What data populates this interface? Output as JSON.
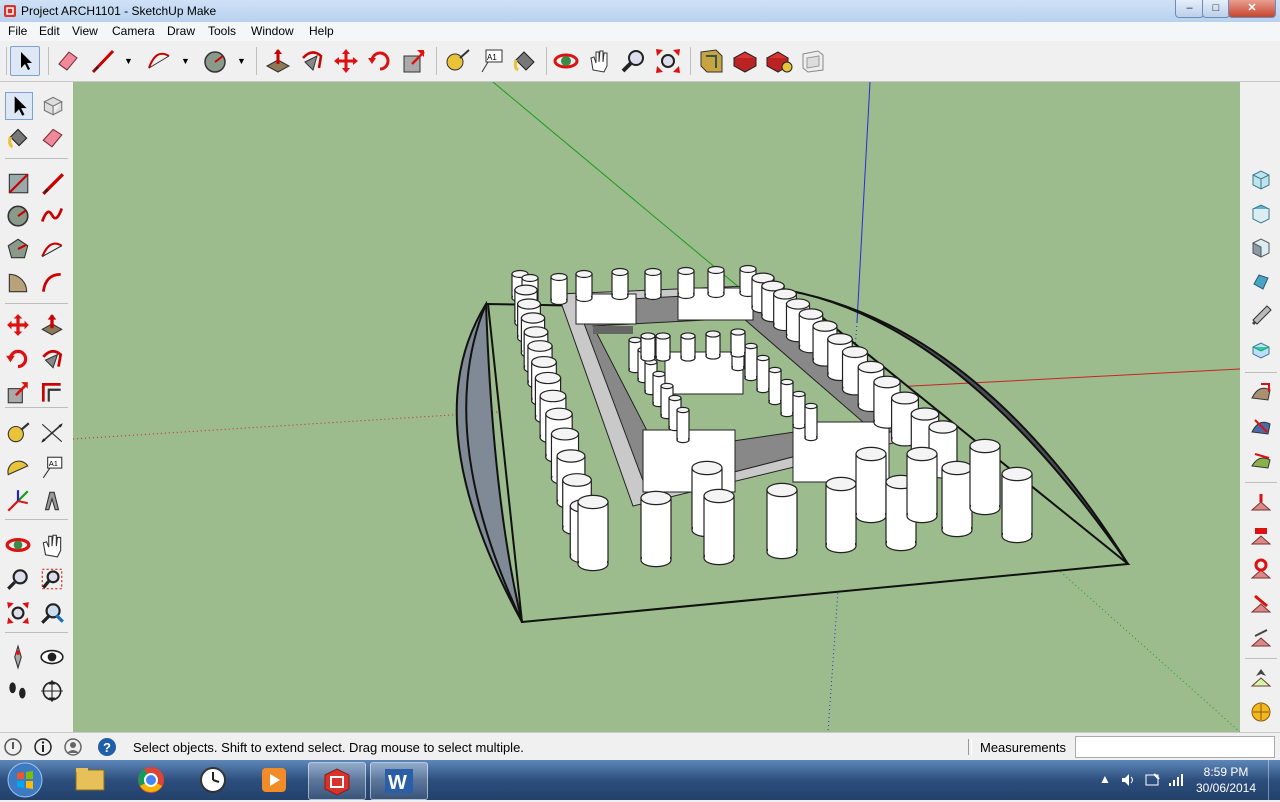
{
  "window": {
    "title": "Project ARCH1101 - SketchUp Make",
    "minimize": "–",
    "maximize": "□",
    "close": "✕"
  },
  "menu": [
    "File",
    "Edit",
    "View",
    "Camera",
    "Draw",
    "Tools",
    "Window",
    "Help"
  ],
  "toolbar": {
    "tools": [
      "select-icon",
      "eraser-icon",
      "line-icon",
      "arc-icon",
      "circle-icon",
      "push-pull-icon",
      "follow-me-icon",
      "move-icon",
      "rotate-icon",
      "scale-icon",
      "tape-measure-icon",
      "text-icon",
      "paint-bucket-icon",
      "orbit-icon",
      "pan-icon",
      "zoom-icon",
      "zoom-extents-icon",
      "3d-warehouse-icon",
      "extension-warehouse-icon",
      "share-component-icon",
      "layout-icon"
    ]
  },
  "left_toolbar": {
    "tools": [
      "select-icon",
      "make-component-icon",
      "paint-bucket-icon",
      "eraser-icon",
      "rectangle-icon",
      "line-icon",
      "circle-icon",
      "freehand-icon",
      "polygon-icon",
      "arc-icon",
      "pie-icon",
      "two-point-arc-icon",
      "move-icon",
      "push-pull-icon",
      "rotate-icon",
      "follow-me-icon",
      "scale-icon",
      "offset-icon",
      "tape-measure-icon",
      "dimension-icon",
      "protractor-icon",
      "text-icon",
      "axes-icon",
      "3d-text-icon",
      "orbit-icon",
      "pan-icon",
      "zoom-icon",
      "zoom-window-icon",
      "zoom-extents-icon",
      "previous-view-icon",
      "position-camera-icon",
      "look-around-icon",
      "walk-icon",
      "section-plane-icon"
    ]
  },
  "right_toolbar": {
    "tools": [
      "iso-view-icon",
      "top-view-icon",
      "front-view-icon",
      "right-view-icon",
      "back-view-icon",
      "left-view-icon",
      "sandbox-from-contours-icon",
      "sandbox-from-scratch-icon",
      "smoove-icon",
      "stamp-icon",
      "drape-icon",
      "add-detail-icon",
      "flip-edge-icon",
      "geo-location-icon",
      "toggle-terrain-icon",
      "photo-texture-icon"
    ]
  },
  "status": {
    "message": "Select objects. Shift to extend select. Drag mouse to select multiple.",
    "measurements_label": "Measurements",
    "measurements_value": ""
  },
  "taskbar": {
    "apps": [
      "file-explorer-icon",
      "chrome-icon",
      "clock-app-icon",
      "media-player-icon",
      "sketchup-icon",
      "word-icon"
    ],
    "time": "8:59 PM",
    "date": "30/06/2014"
  },
  "colors": {
    "sky": "#9cbc8e",
    "column": "#ffffff",
    "accent": "#2a61a8"
  }
}
